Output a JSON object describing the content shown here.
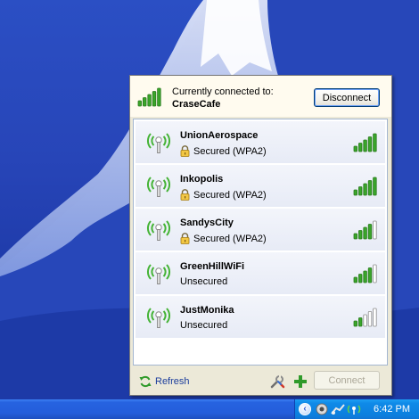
{
  "header": {
    "connected_label": "Currently connected to:",
    "connected_network": "CraseCafe",
    "disconnect_label": "Disconnect",
    "signal_level": 5
  },
  "networks": [
    {
      "name": "UnionAerospace",
      "status": "Secured (WPA2)",
      "secured": true,
      "signal_bars": 5
    },
    {
      "name": "Inkopolis",
      "status": "Secured (WPA2)",
      "secured": true,
      "signal_bars": 5
    },
    {
      "name": "SandysCity",
      "status": "Secured (WPA2)",
      "secured": true,
      "signal_bars": 4
    },
    {
      "name": "GreenHillWiFi",
      "status": "Unsecured",
      "secured": false,
      "signal_bars": 4
    },
    {
      "name": "JustMonika",
      "status": "Unsecured",
      "secured": false,
      "signal_bars": 2
    }
  ],
  "footer": {
    "refresh_label": "Refresh",
    "connect_label": "Connect",
    "connect_enabled": false
  },
  "taskbar": {
    "clock": "6:42 PM"
  },
  "colors": {
    "signal_active": "#3aa52a",
    "signal_inactive": "#ffffff",
    "antenna_waves": "#45b336",
    "desktop": "#2a4cc0",
    "taskbar": "#245ddb"
  },
  "icons": {
    "header": "signal-bars-icon",
    "network": "wifi-antenna-icon",
    "lock": "lock-icon",
    "refresh": "refresh-icon",
    "settings": "settings-wrench-icon",
    "add": "add-network-icon"
  }
}
